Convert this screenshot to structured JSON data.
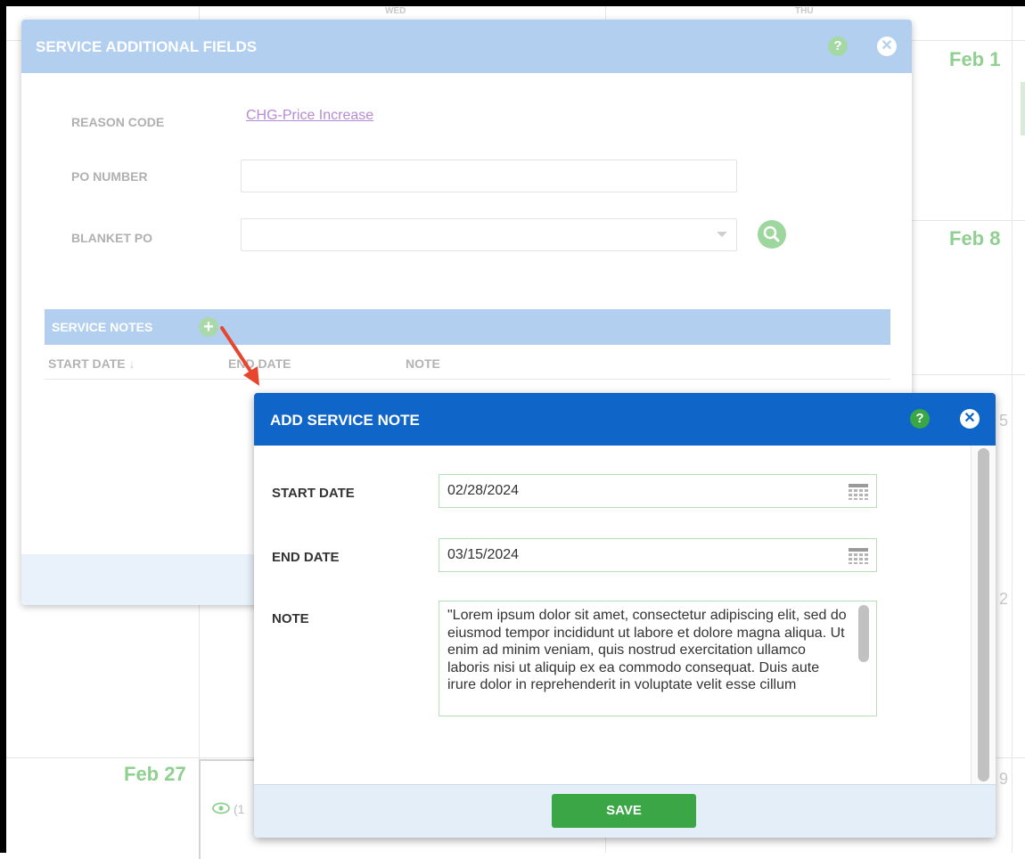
{
  "calendar": {
    "day_headers": [
      "WED",
      "THU"
    ],
    "dates": [
      "Feb 1",
      "Feb 8",
      "Feb 27"
    ],
    "partial_digits": [
      "5",
      "2",
      "9"
    ],
    "eye_count": "(1"
  },
  "dialog_service_fields": {
    "title": "SERVICE ADDITIONAL FIELDS",
    "help_label": "?",
    "reason_code_label": "REASON CODE",
    "reason_code_value": "CHG-Price Increase",
    "po_number_label": "PO NUMBER",
    "po_number_value": "",
    "blanket_po_label": "BLANKET PO",
    "blanket_po_value": "",
    "notes_section_title": "SERVICE NOTES",
    "add_note_label": "+",
    "columns": [
      "START DATE",
      "END DATE",
      "NOTE"
    ],
    "colors": {
      "header": "#b3cfef",
      "link": "#b58bd6"
    }
  },
  "dialog_add_note": {
    "title": "ADD SERVICE NOTE",
    "help_label": "?",
    "start_date_label": "START DATE",
    "start_date_value": "02/28/2024",
    "end_date_label": "END DATE",
    "end_date_value": "03/15/2024",
    "note_label": "NOTE",
    "note_value": "\"Lorem ipsum dolor sit amet, consectetur adipiscing elit, sed do eiusmod tempor incididunt ut labore et dolore magna aliqua. Ut enim ad minim veniam, quis nostrud exercitation ullamco laboris nisi ut aliquip ex ea commodo consequat. Duis aute irure dolor in reprehenderit in voluptate velit esse cillum",
    "save_label": "SAVE",
    "colors": {
      "header": "#0f66c8",
      "save": "#3aa645"
    }
  }
}
